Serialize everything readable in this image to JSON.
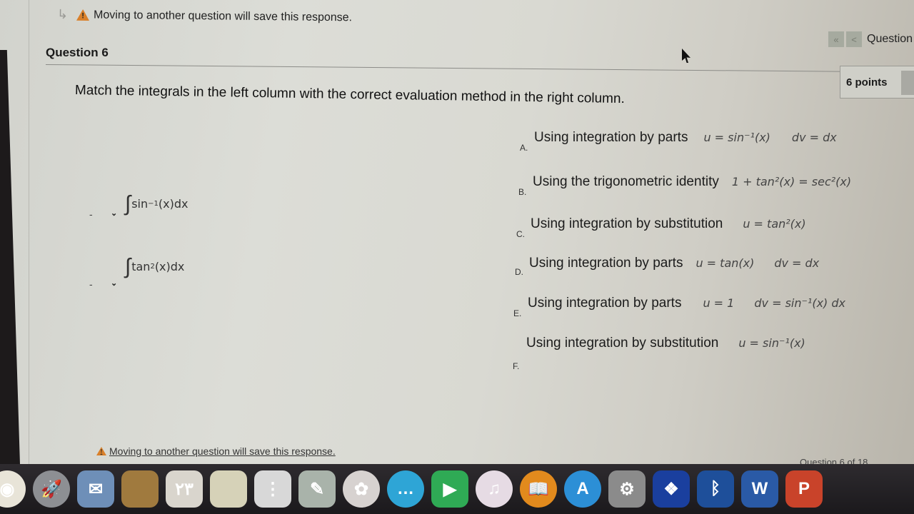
{
  "header": {
    "warning_text": "Moving to another question will save this response.",
    "question_nav": {
      "first_label": "«",
      "prev_label": "<",
      "label": "Question"
    }
  },
  "question": {
    "title": "Question 6",
    "points": "6 points",
    "prompt": "Match the integrals in the left column with the correct evaluation method in the right column.",
    "left_items": [
      {
        "dash": "-",
        "selected": "",
        "integrand": "sin",
        "sup": "−1",
        "rest": "(x)dx"
      },
      {
        "dash": "-",
        "selected": "",
        "integrand": "tan",
        "sup": "2",
        "rest": "(x)dx"
      }
    ],
    "right_options": [
      {
        "letter": "A.",
        "text": "Using integration by parts",
        "math1": "u = sin⁻¹(x)",
        "math2": "dv = dx"
      },
      {
        "letter": "B.",
        "text": "Using the trigonometric identity",
        "math1": "1 + tan²(x) = sec²(x)",
        "math2": ""
      },
      {
        "letter": "C.",
        "text": "Using integration by substitution",
        "math1": "u = tan²(x)",
        "math2": ""
      },
      {
        "letter": "D.",
        "text": "Using integration by parts",
        "math1": "u = tan(x)",
        "math2": "dv = dx"
      },
      {
        "letter": "E.",
        "text": "Using integration by parts",
        "math1": "u = 1",
        "math2": "dv = sin⁻¹(x) dx"
      },
      {
        "letter": "F.",
        "text": "Using integration by substitution",
        "math1": "u = sin⁻¹(x)",
        "math2": ""
      }
    ]
  },
  "footer": {
    "warning_text": "Moving to another question will save this response.",
    "counter": "Question 6 of 18"
  },
  "dock": {
    "apps": [
      {
        "name": "chrome",
        "glyph": "◉",
        "color": "#e8e4d8"
      },
      {
        "name": "launchpad",
        "glyph": "🚀",
        "color": "#8d8f93"
      },
      {
        "name": "mail-stamp",
        "glyph": "✉",
        "color": "#6e8fb8"
      },
      {
        "name": "folder",
        "glyph": "",
        "color": "#a07a3e"
      },
      {
        "name": "calendar",
        "glyph": "٢٣",
        "color": "#d9d5cd"
      },
      {
        "name": "notes",
        "glyph": "",
        "color": "#d6d2b8"
      },
      {
        "name": "reminders",
        "glyph": "⋮",
        "color": "#d8d8d8"
      },
      {
        "name": "preview",
        "glyph": "✎",
        "color": "#a9b3aa"
      },
      {
        "name": "photos",
        "glyph": "✿",
        "color": "#d7d2d0"
      },
      {
        "name": "messages",
        "glyph": "…",
        "color": "#2ea5d6"
      },
      {
        "name": "facetime",
        "glyph": "▶",
        "color": "#2faa55"
      },
      {
        "name": "itunes",
        "glyph": "♫",
        "color": "#e6dbe4"
      },
      {
        "name": "ibooks",
        "glyph": "📖",
        "color": "#e28a1d"
      },
      {
        "name": "app-store",
        "glyph": "A",
        "color": "#2c8fd6"
      },
      {
        "name": "system-preferences",
        "glyph": "⚙",
        "color": "#8b8b8b"
      },
      {
        "name": "dropbox",
        "glyph": "❖",
        "color": "#1a3f9e"
      },
      {
        "name": "bluetooth",
        "glyph": "ᛒ",
        "color": "#1e4f9a"
      },
      {
        "name": "word",
        "glyph": "W",
        "color": "#2a5aa6"
      },
      {
        "name": "powerpoint",
        "glyph": "P",
        "color": "#c9432a"
      }
    ]
  }
}
